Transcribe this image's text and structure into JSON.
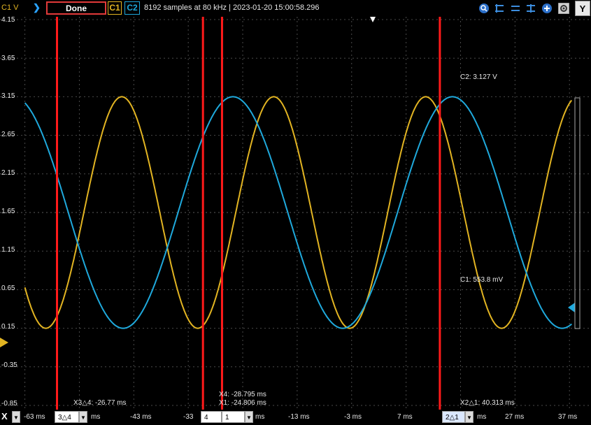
{
  "top": {
    "axis_unit": "C1 V",
    "status": "Done",
    "ch1": "C1",
    "ch2": "C2",
    "info": "8192 samples at 80 kHz | 2023-01-20 15:00:58.296",
    "y_button": "Y",
    "icons": [
      "zoom-fit-icon",
      "cursor-add-icon",
      "cursor-remove-icon",
      "cursor-both-icon",
      "zoom-in-icon",
      "zoom-out-icon",
      "settings-icon"
    ]
  },
  "colors": {
    "c1": "#e2b422",
    "c2": "#1fa9dc",
    "cursor": "#ff1a1a",
    "grid": "#4a4a4a"
  },
  "y_ticks": [
    "4.15",
    "3.65",
    "3.15",
    "2.65",
    "2.15",
    "1.65",
    "1.15",
    "0.65",
    "0.15",
    "-0.35",
    "-0.85"
  ],
  "x_axis": {
    "letter": "X",
    "ticks": [
      "-63 ms",
      "ms",
      "-43 ms",
      "-33",
      "ms",
      "-13 ms",
      "-3 ms",
      "7 ms",
      "ms",
      "27 ms",
      "37 ms"
    ]
  },
  "controls": {
    "pair1": "3△4",
    "field_4": "4",
    "field_1": "1",
    "pair2": "2△1"
  },
  "cursor_labels": {
    "c2": "C2: 3.127 V",
    "c1": "C1: 553.8 mV",
    "x3x4": "X3△4: -26.77 ms",
    "x4": "X4: -28.795 ms",
    "x1": "X1: -24.806 ms",
    "x2x1": "X2△1: 40.313 ms"
  },
  "chart_data": {
    "type": "line",
    "ylabel": "C1 V",
    "ylim": [
      -0.85,
      4.15
    ],
    "xlim": [
      -65,
      38
    ],
    "series": [
      {
        "name": "C1",
        "description_values": {
          "amplitude": 1.5,
          "offset": 1.65,
          "period_ms": 27.9,
          "peak_time_ms": -45.2
        }
      },
      {
        "name": "C2",
        "description_values": {
          "amplitude": 1.5,
          "offset": 1.65,
          "period_ms": 40.3,
          "peak_time_ms": -24.8
        }
      }
    ]
  }
}
